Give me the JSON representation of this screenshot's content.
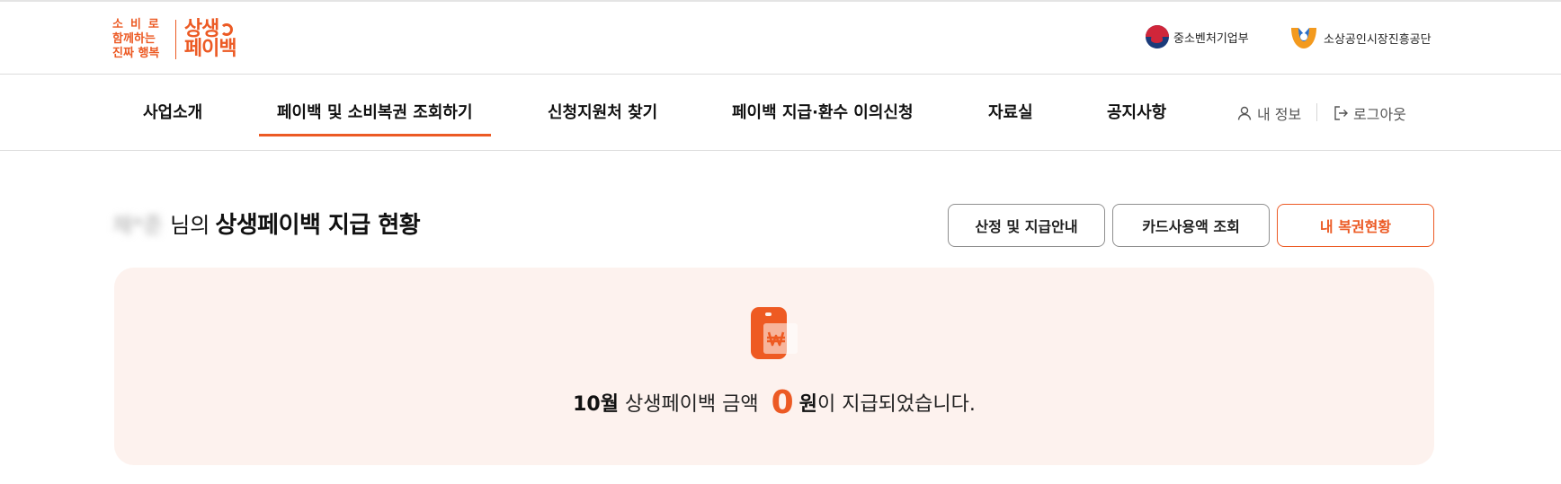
{
  "header": {
    "logo": {
      "slogan_line1": "소비로",
      "slogan_line2": "함께하는",
      "slogan_line3": "진짜 행복",
      "brand_line1": "상생",
      "brand_line2": "페이백"
    },
    "orgs": [
      {
        "label": "중소벤처기업부",
        "icon": "government-emblem-icon"
      },
      {
        "label": "소상공인시장진흥공단",
        "icon": "semas-logo-icon"
      }
    ]
  },
  "nav": {
    "items": [
      {
        "label": "사업소개",
        "active": false
      },
      {
        "label": "페이백 및 소비복권 조회하기",
        "active": true
      },
      {
        "label": "신청지원처 찾기",
        "active": false
      },
      {
        "label": "페이백 지급·환수 이의신청",
        "active": false
      },
      {
        "label": "자료실",
        "active": false
      },
      {
        "label": "공지사항",
        "active": false
      }
    ],
    "my_info": "내 정보",
    "logout": "로그아웃"
  },
  "status": {
    "user_name": "채*준",
    "name_suffix": "님의",
    "title": "상생페이백 지급 현황",
    "buttons": {
      "guide": "산정 및 지급안내",
      "card_usage": "카드사용액 조회",
      "my_coupon": "내 복권현황"
    },
    "month": "10월",
    "label": "상생페이백 금액",
    "amount": "0",
    "unit": "원",
    "tail": "이 지급되었습니다."
  },
  "colors": {
    "accent": "#ec5a24",
    "panel_bg": "#fdf2ee",
    "border": "#dcdcdc"
  }
}
